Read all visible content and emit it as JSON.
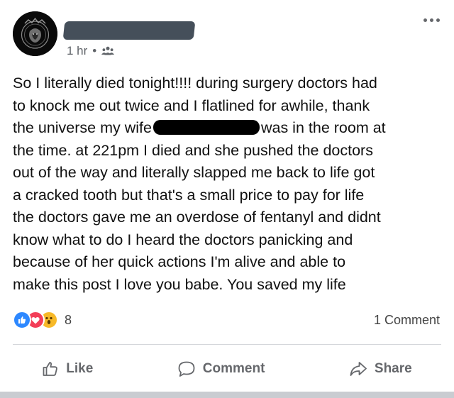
{
  "post": {
    "meta": {
      "time": "1 hr",
      "separator": "•",
      "audience_icon": "friends-icon"
    },
    "text_lines": [
      {
        "a": "So I literally died tonight!!!!  during surgery doctors had"
      },
      {
        "a": "to knock me out twice and I flatlined for awhile, thank"
      },
      {
        "a": "the universe my wife",
        "b": "was in the room at"
      },
      {
        "a": "the time. at 221pm I died and she pushed the doctors"
      },
      {
        "a": "out of the way and literally slapped me back to life got"
      },
      {
        "a": "a cracked tooth but that's a small price to pay for life"
      },
      {
        "a": "the doctors gave me an overdose of fentanyl and didnt"
      },
      {
        "a": "know what to do I heard the doctors panicking and"
      },
      {
        "a": "because of her quick actions I'm alive and able to"
      },
      {
        "a": "make this post I love you babe. You saved my life"
      }
    ],
    "reactions": {
      "count": "8",
      "types": [
        "like-icon",
        "love-icon",
        "wow-icon"
      ]
    },
    "comments": {
      "label": "1 Comment"
    },
    "actions": {
      "like": "Like",
      "comment": "Comment",
      "share": "Share"
    }
  },
  "colors": {
    "like": "#2d88ff",
    "love": "#f33e58",
    "wow": "#f7b928",
    "text": "#111111",
    "muted": "#65676b"
  }
}
